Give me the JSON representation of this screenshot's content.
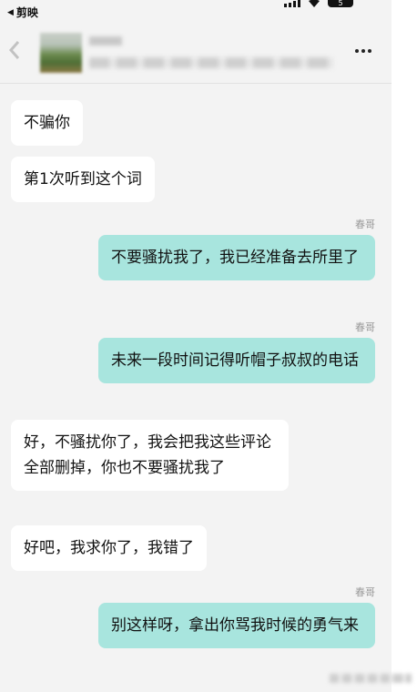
{
  "status_bar": {
    "back_app_label": "剪映",
    "battery_level": "5"
  },
  "header": {
    "more_label": "更多"
  },
  "messages": [
    {
      "side": "in",
      "text": "不骗你"
    },
    {
      "side": "in",
      "text": "第1次听到这个词"
    },
    {
      "side": "out",
      "sender": "春哥",
      "text": "不要骚扰我了，我已经准备去所里了"
    },
    {
      "side": "out",
      "sender": "春哥",
      "text": "未来一段时间记得听帽子叔叔的电话"
    },
    {
      "side": "in",
      "text": "好，不骚扰你了，我会把我这些评论全部删掉，你也不要骚扰我了"
    },
    {
      "side": "in",
      "text": "好吧，我求你了，我错了"
    },
    {
      "side": "out",
      "sender": "春哥",
      "text": "别这样呀，拿出你骂我时候的勇气来"
    }
  ],
  "colors": {
    "chat_background": "#f3f3f3",
    "incoming_bubble": "#ffffff",
    "outgoing_bubble": "#a8e5de",
    "sender_label": "#9a9a9a"
  }
}
